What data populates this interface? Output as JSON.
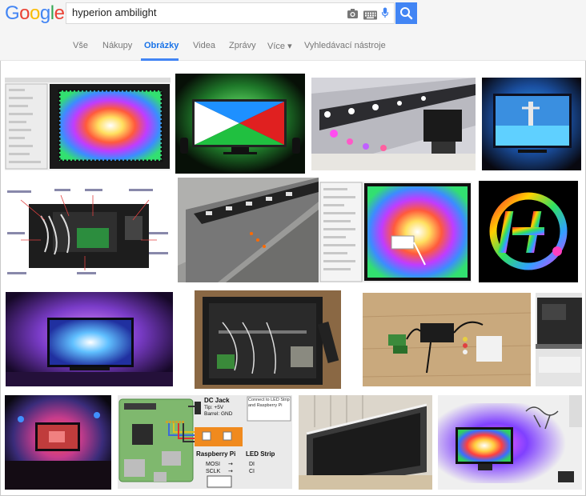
{
  "logo": {
    "letters": [
      "G",
      "o",
      "o",
      "g",
      "l",
      "e"
    ],
    "colors": [
      "#4285f4",
      "#ea4335",
      "#fbbc05",
      "#4285f4",
      "#34a853",
      "#ea4335"
    ]
  },
  "search": {
    "query": "hyperion ambilight"
  },
  "tabs": [
    {
      "label": "Vše",
      "active": false
    },
    {
      "label": "Nákupy",
      "active": false
    },
    {
      "label": "Obrázky",
      "active": true
    },
    {
      "label": "Videa",
      "active": false
    },
    {
      "label": "Zprávy",
      "active": false
    },
    {
      "label": "Více ▾",
      "active": false
    },
    {
      "label": "Vyhledávací nástroje",
      "active": false
    }
  ],
  "diagram": {
    "dc_jack": "DC Jack",
    "tip": "Tip: +5V",
    "barrel": "Barrel: GND",
    "connect_note": "Connect to LED Strip and Raspberry Pi",
    "rpi": "Raspberry Pi",
    "led": "LED Strip",
    "mosi": "MOSI",
    "sclk": "SCLK",
    "di": "DI",
    "ci": "CI",
    "arrow": "→"
  },
  "colors": {
    "accent": "#4285f4",
    "tab_text": "#777777",
    "header_bg": "#f5f5f5"
  }
}
